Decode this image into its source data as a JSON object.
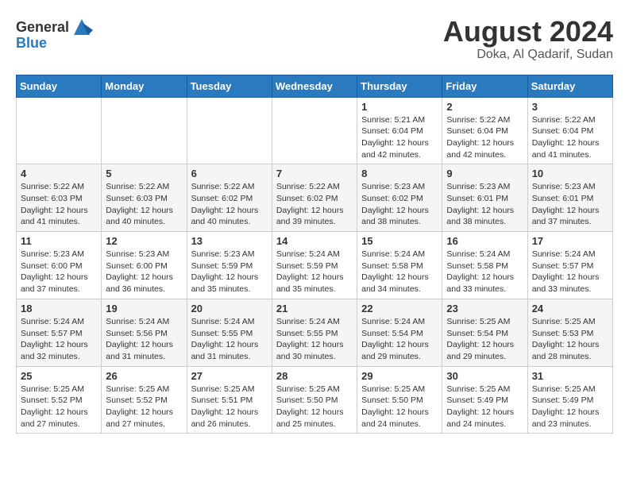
{
  "logo": {
    "general": "General",
    "blue": "Blue"
  },
  "title": "August 2024",
  "location": "Doka, Al Qadarif, Sudan",
  "days_of_week": [
    "Sunday",
    "Monday",
    "Tuesday",
    "Wednesday",
    "Thursday",
    "Friday",
    "Saturday"
  ],
  "weeks": [
    [
      {
        "day": "",
        "info": ""
      },
      {
        "day": "",
        "info": ""
      },
      {
        "day": "",
        "info": ""
      },
      {
        "day": "",
        "info": ""
      },
      {
        "day": "1",
        "info": "Sunrise: 5:21 AM\nSunset: 6:04 PM\nDaylight: 12 hours and 42 minutes."
      },
      {
        "day": "2",
        "info": "Sunrise: 5:22 AM\nSunset: 6:04 PM\nDaylight: 12 hours and 42 minutes."
      },
      {
        "day": "3",
        "info": "Sunrise: 5:22 AM\nSunset: 6:04 PM\nDaylight: 12 hours and 41 minutes."
      }
    ],
    [
      {
        "day": "4",
        "info": "Sunrise: 5:22 AM\nSunset: 6:03 PM\nDaylight: 12 hours and 41 minutes."
      },
      {
        "day": "5",
        "info": "Sunrise: 5:22 AM\nSunset: 6:03 PM\nDaylight: 12 hours and 40 minutes."
      },
      {
        "day": "6",
        "info": "Sunrise: 5:22 AM\nSunset: 6:02 PM\nDaylight: 12 hours and 40 minutes."
      },
      {
        "day": "7",
        "info": "Sunrise: 5:22 AM\nSunset: 6:02 PM\nDaylight: 12 hours and 39 minutes."
      },
      {
        "day": "8",
        "info": "Sunrise: 5:23 AM\nSunset: 6:02 PM\nDaylight: 12 hours and 38 minutes."
      },
      {
        "day": "9",
        "info": "Sunrise: 5:23 AM\nSunset: 6:01 PM\nDaylight: 12 hours and 38 minutes."
      },
      {
        "day": "10",
        "info": "Sunrise: 5:23 AM\nSunset: 6:01 PM\nDaylight: 12 hours and 37 minutes."
      }
    ],
    [
      {
        "day": "11",
        "info": "Sunrise: 5:23 AM\nSunset: 6:00 PM\nDaylight: 12 hours and 37 minutes."
      },
      {
        "day": "12",
        "info": "Sunrise: 5:23 AM\nSunset: 6:00 PM\nDaylight: 12 hours and 36 minutes."
      },
      {
        "day": "13",
        "info": "Sunrise: 5:23 AM\nSunset: 5:59 PM\nDaylight: 12 hours and 35 minutes."
      },
      {
        "day": "14",
        "info": "Sunrise: 5:24 AM\nSunset: 5:59 PM\nDaylight: 12 hours and 35 minutes."
      },
      {
        "day": "15",
        "info": "Sunrise: 5:24 AM\nSunset: 5:58 PM\nDaylight: 12 hours and 34 minutes."
      },
      {
        "day": "16",
        "info": "Sunrise: 5:24 AM\nSunset: 5:58 PM\nDaylight: 12 hours and 33 minutes."
      },
      {
        "day": "17",
        "info": "Sunrise: 5:24 AM\nSunset: 5:57 PM\nDaylight: 12 hours and 33 minutes."
      }
    ],
    [
      {
        "day": "18",
        "info": "Sunrise: 5:24 AM\nSunset: 5:57 PM\nDaylight: 12 hours and 32 minutes."
      },
      {
        "day": "19",
        "info": "Sunrise: 5:24 AM\nSunset: 5:56 PM\nDaylight: 12 hours and 31 minutes."
      },
      {
        "day": "20",
        "info": "Sunrise: 5:24 AM\nSunset: 5:55 PM\nDaylight: 12 hours and 31 minutes."
      },
      {
        "day": "21",
        "info": "Sunrise: 5:24 AM\nSunset: 5:55 PM\nDaylight: 12 hours and 30 minutes."
      },
      {
        "day": "22",
        "info": "Sunrise: 5:24 AM\nSunset: 5:54 PM\nDaylight: 12 hours and 29 minutes."
      },
      {
        "day": "23",
        "info": "Sunrise: 5:25 AM\nSunset: 5:54 PM\nDaylight: 12 hours and 29 minutes."
      },
      {
        "day": "24",
        "info": "Sunrise: 5:25 AM\nSunset: 5:53 PM\nDaylight: 12 hours and 28 minutes."
      }
    ],
    [
      {
        "day": "25",
        "info": "Sunrise: 5:25 AM\nSunset: 5:52 PM\nDaylight: 12 hours and 27 minutes."
      },
      {
        "day": "26",
        "info": "Sunrise: 5:25 AM\nSunset: 5:52 PM\nDaylight: 12 hours and 27 minutes."
      },
      {
        "day": "27",
        "info": "Sunrise: 5:25 AM\nSunset: 5:51 PM\nDaylight: 12 hours and 26 minutes."
      },
      {
        "day": "28",
        "info": "Sunrise: 5:25 AM\nSunset: 5:50 PM\nDaylight: 12 hours and 25 minutes."
      },
      {
        "day": "29",
        "info": "Sunrise: 5:25 AM\nSunset: 5:50 PM\nDaylight: 12 hours and 24 minutes."
      },
      {
        "day": "30",
        "info": "Sunrise: 5:25 AM\nSunset: 5:49 PM\nDaylight: 12 hours and 24 minutes."
      },
      {
        "day": "31",
        "info": "Sunrise: 5:25 AM\nSunset: 5:49 PM\nDaylight: 12 hours and 23 minutes."
      }
    ]
  ]
}
